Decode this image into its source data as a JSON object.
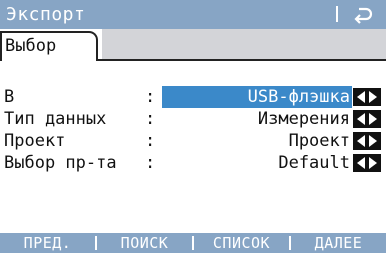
{
  "window": {
    "title": "Экспорт"
  },
  "tabs": [
    {
      "label": "Выбор",
      "active": true
    }
  ],
  "fields": [
    {
      "label": "В",
      "value": "USB-флэшка",
      "selected": true
    },
    {
      "label": "Тип данных",
      "value": "Измерения",
      "selected": false
    },
    {
      "label": "Проект",
      "value": "Проект",
      "selected": false
    },
    {
      "label": "Выбор пр-та",
      "value": "Default",
      "selected": false
    }
  ],
  "colon": ":",
  "softkeys": [
    {
      "label": "ПРЕД."
    },
    {
      "label": "ПОИСК"
    },
    {
      "label": "СПИСОК"
    },
    {
      "label": "ДАЛЕЕ"
    }
  ],
  "colors": {
    "titlebar": "#87a5c5",
    "selection": "#3b89c9",
    "tab_inactive": "#d3d4d8"
  },
  "icons": {
    "back": "back-arrow-icon",
    "selector": "left-right-arrows-icon"
  }
}
